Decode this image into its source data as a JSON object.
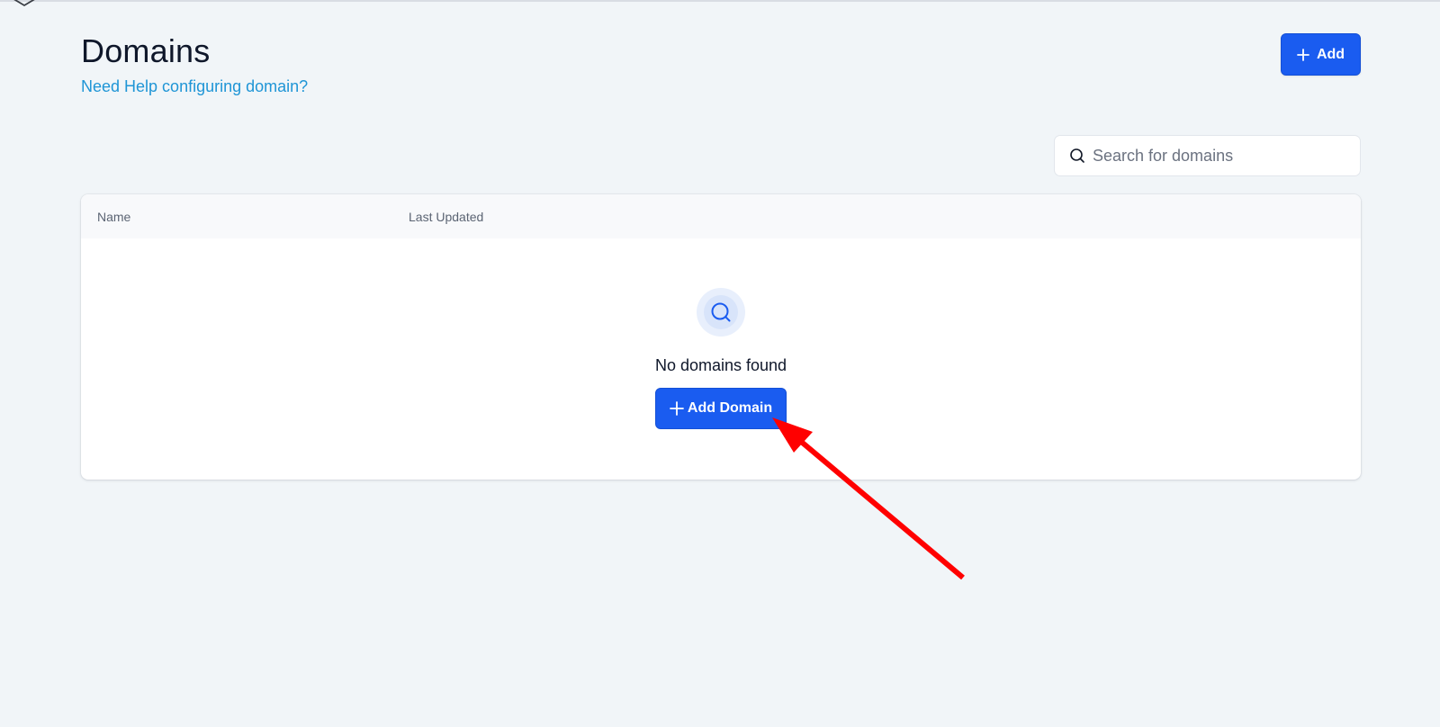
{
  "header": {
    "title": "Domains",
    "help_link": "Need Help configuring domain?",
    "add_label": "Add"
  },
  "search": {
    "placeholder": "Search for domains"
  },
  "table": {
    "columns": [
      "Name",
      "Last Updated"
    ],
    "rows": []
  },
  "empty_state": {
    "message": "No domains found",
    "button_label": "Add Domain"
  },
  "colors": {
    "primary": "#1a5cf0",
    "link": "#1f95d6",
    "background": "#f1f5f8",
    "annotation_arrow": "#ff0000"
  },
  "icons": {
    "logo": "cube-outline-icon",
    "add": "plus-icon",
    "search": "search-icon",
    "empty": "search-icon",
    "annotation": "red-arrow-annotation"
  }
}
